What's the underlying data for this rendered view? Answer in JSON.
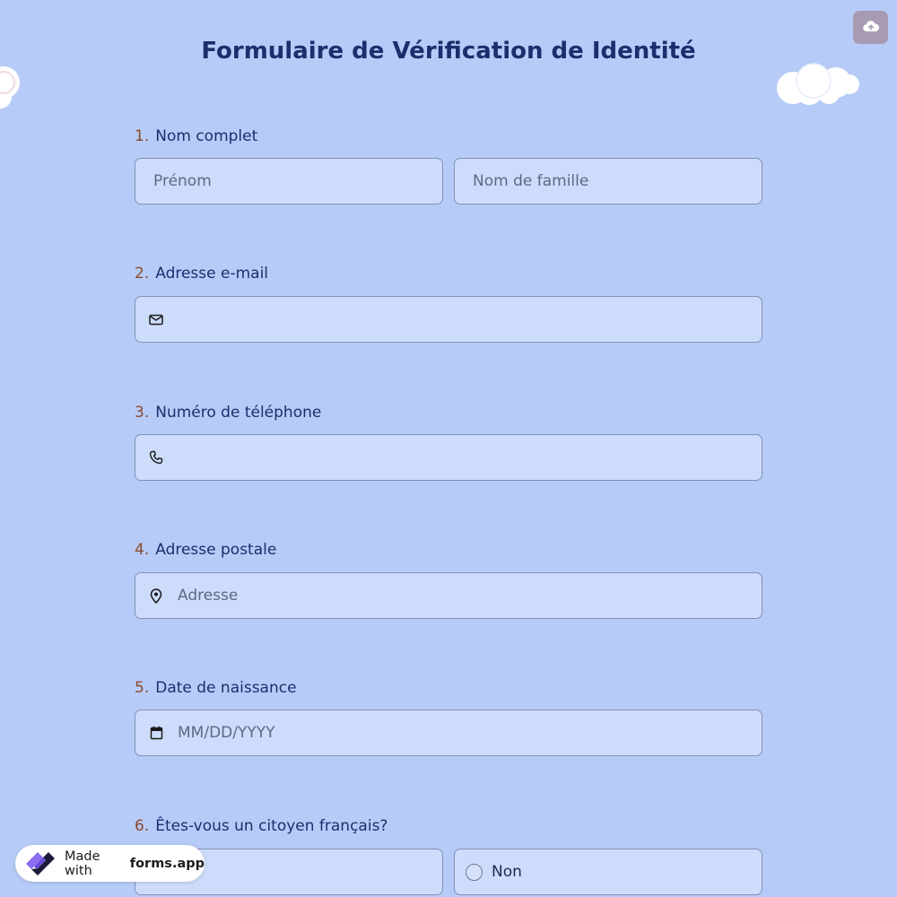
{
  "form": {
    "title": "Formulaire de Vérification de Identité",
    "questions": [
      {
        "number": "1.",
        "label": "Nom complet",
        "first_name_placeholder": "Prénom",
        "last_name_placeholder": "Nom de famille"
      },
      {
        "number": "2.",
        "label": "Adresse e-mail",
        "icon": "mail-icon"
      },
      {
        "number": "3.",
        "label": "Numéro de téléphone",
        "icon": "phone-icon"
      },
      {
        "number": "4.",
        "label": "Adresse postale",
        "icon": "location-pin-icon",
        "placeholder": "Adresse"
      },
      {
        "number": "5.",
        "label": "Date de naissance",
        "icon": "calendar-icon",
        "placeholder": "MM/DD/YYYY"
      },
      {
        "number": "6.",
        "label": "Êtes-vous un citoyen français?",
        "options": [
          "",
          "Non"
        ]
      }
    ]
  },
  "upload_button": {
    "icon": "cloud-upload-icon"
  },
  "badge": {
    "prefix": "Made with",
    "brand": "forms.app",
    "icon": "forms-app-logo-icon"
  },
  "colors": {
    "background": "#b6cbf7",
    "field": "#cddcfa",
    "title": "#1d2e6e",
    "number": "#8a4a2c",
    "upload": "#a79bb4"
  }
}
